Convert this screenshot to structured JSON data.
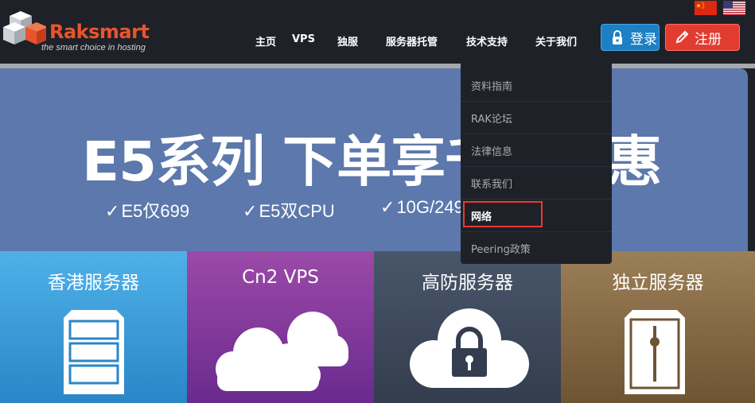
{
  "brand": {
    "name": "Raksmart",
    "tagline": "the smart choice in hosting"
  },
  "nav": {
    "items": [
      "主页",
      "VPS",
      "独服",
      "服务器托管",
      "技术支持",
      "关于我们"
    ]
  },
  "auth": {
    "login_label": "登录",
    "register_label": "注册"
  },
  "hero": {
    "title": "E5系列 下单享千元优惠",
    "features": [
      "E5仅699",
      "E5双CPU",
      "10G/249"
    ]
  },
  "dropdown": {
    "items": [
      "资料指南",
      "RAK论坛",
      "法律信息",
      "联系我们",
      "网络",
      "Peering政策"
    ],
    "active_item": "网络"
  },
  "tiles": [
    {
      "label": "香港服务器",
      "icon": "server-rack-icon"
    },
    {
      "label": "Cn2 VPS",
      "icon": "cloud-icon"
    },
    {
      "label": "高防服务器",
      "icon": "cloud-lock-icon"
    },
    {
      "label": "独立服务器",
      "icon": "server-tower-icon"
    }
  ],
  "flags": [
    "cn-flag-icon",
    "us-flag-icon"
  ],
  "colors": {
    "brand_orange": "#e8552c",
    "header_bg": "#1f2128",
    "hero_bg": "#5c78ac",
    "login_blue": "#1d80c4",
    "register_red": "#e23c31",
    "highlight_red": "#e63a32"
  }
}
